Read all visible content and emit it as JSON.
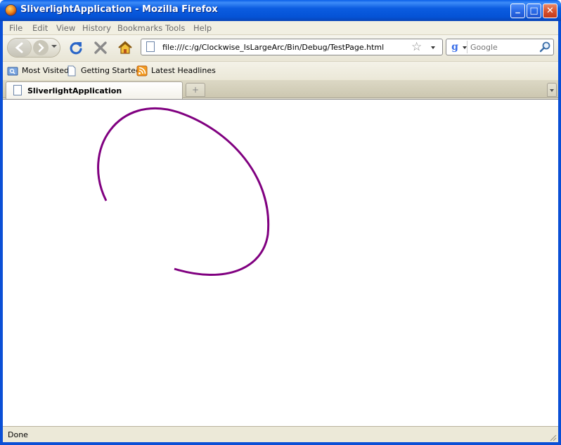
{
  "window": {
    "title": "SliverlightApplication - Mozilla Firefox",
    "buttons": {
      "minimize": "_",
      "maximize": "□",
      "close": "✕"
    }
  },
  "menubar": {
    "items": [
      "File",
      "Edit",
      "View",
      "History",
      "Bookmarks",
      "Tools",
      "Help"
    ]
  },
  "navbar": {
    "back_icon": "back-arrow-icon",
    "forward_icon": "forward-arrow-icon",
    "reload_icon": "reload-icon",
    "stop_icon": "stop-icon",
    "home_icon": "home-icon",
    "url": "file:///c:/g/Clockwise_IsLargeArc/Bin/Debug/TestPage.html",
    "search_placeholder": "Google"
  },
  "bookmarks": {
    "items": [
      {
        "label": "Most Visited",
        "icon": "smart-folder-icon"
      },
      {
        "label": "Getting Started",
        "icon": "page-icon"
      },
      {
        "label": "Latest Headlines",
        "icon": "rss-feed-icon"
      }
    ]
  },
  "tabs": {
    "active_label": "SliverlightApplication",
    "new_tab_glyph": "+"
  },
  "content": {
    "arc": {
      "stroke": "#800080",
      "sweep": "clockwise",
      "large_arc": true
    }
  },
  "statusbar": {
    "text": "Done"
  },
  "colors": {
    "titlebar": "#0a5fe8",
    "chrome": "#ece9d8",
    "arc": "#800080"
  }
}
